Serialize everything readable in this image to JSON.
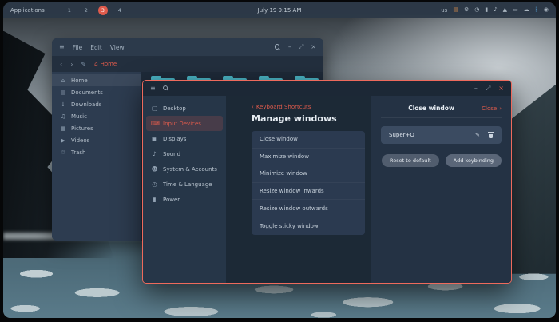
{
  "colors": {
    "accent": "#df5b4c",
    "window_border": "#ee6a5c",
    "folder": "#4ab3c3",
    "bluetooth": "#58a6dd",
    "tray_warm": "#d98e4a"
  },
  "icons": {
    "hamburger": "≡",
    "minimize": "–",
    "maximize": "⤢",
    "close": "×",
    "back_chevron": "‹",
    "forward_chevron": "›",
    "pencil": "✎",
    "home": "⌂"
  },
  "panel": {
    "app_menu_label": "Applications",
    "workspaces": [
      "1",
      "2",
      "3",
      "4"
    ],
    "active_workspace": "3",
    "clock": "July 19 9:15 AM",
    "keyboard_layout": "us",
    "tray": [
      {
        "name": "indicator-app-icon",
        "glyph": "▤"
      },
      {
        "name": "settings-gear-icon",
        "glyph": "⚙"
      },
      {
        "name": "clock-icon",
        "glyph": "◔"
      },
      {
        "name": "battery-icon",
        "glyph": "▮"
      },
      {
        "name": "volume-icon",
        "glyph": "♪"
      },
      {
        "name": "wifi-icon",
        "glyph": "▲"
      },
      {
        "name": "brightness-icon",
        "glyph": "▭"
      },
      {
        "name": "cloud-icon",
        "glyph": "☁"
      },
      {
        "name": "bluetooth-icon",
        "glyph": "ᛒ"
      },
      {
        "name": "power-icon",
        "glyph": "◉"
      }
    ]
  },
  "files_window": {
    "menu_items": [
      "File",
      "Edit",
      "View"
    ],
    "breadcrumb": "Home",
    "sidebar_items": [
      {
        "icon": "⌂",
        "label": "Home"
      },
      {
        "icon": "▤",
        "label": "Documents"
      },
      {
        "icon": "↓",
        "label": "Downloads"
      },
      {
        "icon": "♫",
        "label": "Music"
      },
      {
        "icon": "▦",
        "label": "Pictures"
      },
      {
        "icon": "▶",
        "label": "Videos"
      },
      {
        "icon": "♲",
        "label": "Trash"
      }
    ],
    "folders": [
      {
        "overlay": ""
      },
      {
        "overlay": "▤"
      },
      {
        "overlay": "▦"
      },
      {
        "overlay": "↓"
      },
      {
        "overlay": ""
      }
    ]
  },
  "settings_window": {
    "sidebar_items": [
      {
        "icon": "▢",
        "label": "Desktop"
      },
      {
        "icon": "⌨",
        "label": "Input Devices"
      },
      {
        "icon": "▣",
        "label": "Displays"
      },
      {
        "icon": "♪",
        "label": "Sound"
      },
      {
        "icon": "☻",
        "label": "System & Accounts"
      },
      {
        "icon": "◷",
        "label": "Time & Language"
      },
      {
        "icon": "▮",
        "label": "Power"
      }
    ],
    "selected_sidebar": "Input Devices",
    "back_link": "Keyboard Shortcuts",
    "section_title": "Manage windows",
    "shortcut_actions": [
      "Close window",
      "Maximize window",
      "Minimize window",
      "Resize window inwards",
      "Resize window outwards",
      "Toggle sticky window"
    ],
    "detail": {
      "title": "Close window",
      "nav_link": "Close",
      "keybinding": "Super+Q",
      "reset_button": "Reset to default",
      "add_button": "Add keybinding"
    }
  }
}
